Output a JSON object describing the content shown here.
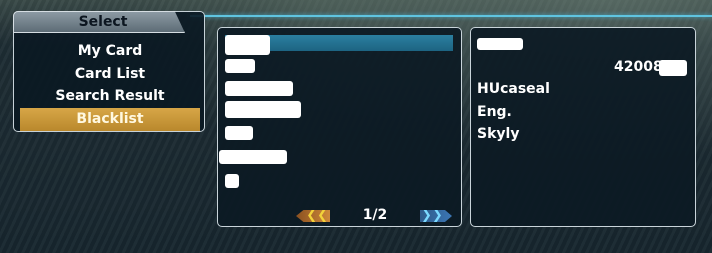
{
  "menu": {
    "title": "Select",
    "items": [
      {
        "label": "My Card",
        "selected": false
      },
      {
        "label": "Card List",
        "selected": false
      },
      {
        "label": "Search Result",
        "selected": false
      },
      {
        "label": "Blacklist",
        "selected": true
      }
    ]
  },
  "list": {
    "page": "1/2",
    "prev_icon": "chevron-left-icon",
    "next_icon": "chevron-right-icon"
  },
  "details": {
    "guildcard_number": "42008",
    "class": "HUcaseal",
    "language": "Eng.",
    "section_id": "Skyly"
  },
  "colors": {
    "accent_line": "#5fc4e0",
    "selected_item": "#c99a3c",
    "list_highlight": "#2477998"
  }
}
